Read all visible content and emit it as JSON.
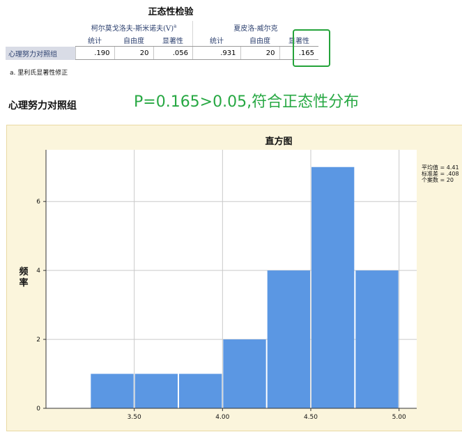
{
  "table": {
    "title": "正态性检验",
    "group1": "柯尔莫戈洛夫-斯米诺夫(V)",
    "group1_sup": "a",
    "group2": "夏皮洛-威尔克",
    "columns": [
      "统计",
      "自由度",
      "显著性",
      "统计",
      "自由度",
      "显著性"
    ],
    "row": {
      "label": "心理努力对照组",
      "values": [
        ".190",
        "20",
        ".056",
        ".931",
        "20",
        ".165"
      ]
    },
    "footnote": "a. 里利氏显著性修正"
  },
  "group_label": "心理努力对照组",
  "annotation": "P=0.165>0.05,符合正态性分布",
  "colors": {
    "bar": "#5b97e3",
    "highlight": "#24a33a",
    "annotation": "#27a843",
    "plot_bg": "#ffffff",
    "frame_bg": "#fbf5dc"
  },
  "chart_data": {
    "type": "bar",
    "title": "直方图",
    "ylabel": "频率",
    "xlabel": "",
    "bin_edges": [
      3.25,
      3.5,
      3.75,
      4.0,
      4.25,
      4.5,
      4.75,
      5.0
    ],
    "values": [
      1,
      1,
      1,
      2,
      4,
      7,
      4
    ],
    "xticks": [
      3.5,
      4.0,
      4.5,
      5.0
    ],
    "xtick_labels": [
      "3.50",
      "4.00",
      "4.50",
      "5.00"
    ],
    "yticks": [
      0,
      2,
      4,
      6
    ],
    "ylim": [
      0,
      7.5
    ],
    "xlim": [
      3.0,
      5.1
    ],
    "grid": true,
    "stats": [
      "平均值 = 4.41",
      "标准差 = .408",
      "个案数 = 20"
    ]
  }
}
